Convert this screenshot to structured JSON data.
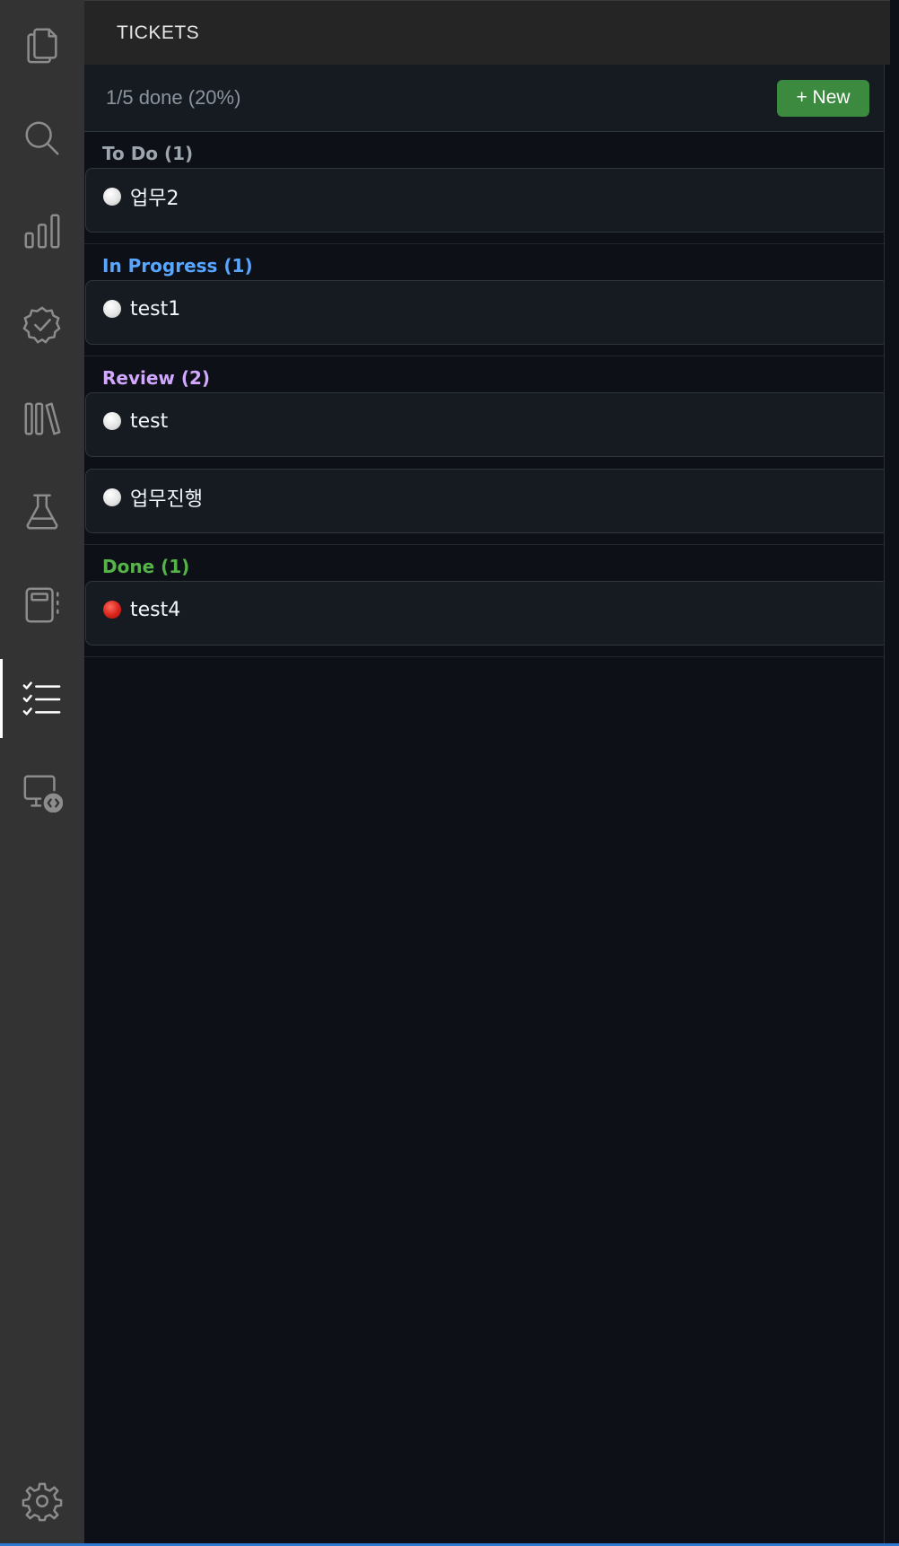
{
  "activity_bar": {
    "items": [
      {
        "icon": "files-icon",
        "active": false
      },
      {
        "icon": "search-icon",
        "active": false
      },
      {
        "icon": "chart-icon",
        "active": false
      },
      {
        "icon": "verified-icon",
        "active": false
      },
      {
        "icon": "library-icon",
        "active": false
      },
      {
        "icon": "flask-icon",
        "active": false
      },
      {
        "icon": "notebook-icon",
        "active": false
      },
      {
        "icon": "tasklist-icon",
        "active": true
      },
      {
        "icon": "remote-explorer-icon",
        "active": false
      }
    ],
    "settings_icon": "gear-icon"
  },
  "panel": {
    "title": "TICKETS",
    "summary": "1/5 done (20%)",
    "new_button_label": "+ New"
  },
  "sections": [
    {
      "title": "To Do (1)",
      "color": "#9da5ae",
      "tickets": [
        {
          "title": "업무2",
          "status_dot": "white"
        }
      ]
    },
    {
      "title": "In Progress (1)",
      "color": "#58a6ff",
      "tickets": [
        {
          "title": "test1",
          "status_dot": "white"
        }
      ]
    },
    {
      "title": "Review (2)",
      "color": "#d2a8ff",
      "tickets": [
        {
          "title": "test",
          "status_dot": "white"
        },
        {
          "title": "업무진행",
          "status_dot": "white"
        }
      ]
    },
    {
      "title": "Done (1)",
      "color": "#56b34a",
      "tickets": [
        {
          "title": "test4",
          "status_dot": "red"
        }
      ]
    }
  ],
  "colors": {
    "accent_green": "#3c8a3f",
    "activity_bar_bg": "#333333",
    "panel_bg": "#0d1117",
    "card_bg": "#161b22"
  }
}
